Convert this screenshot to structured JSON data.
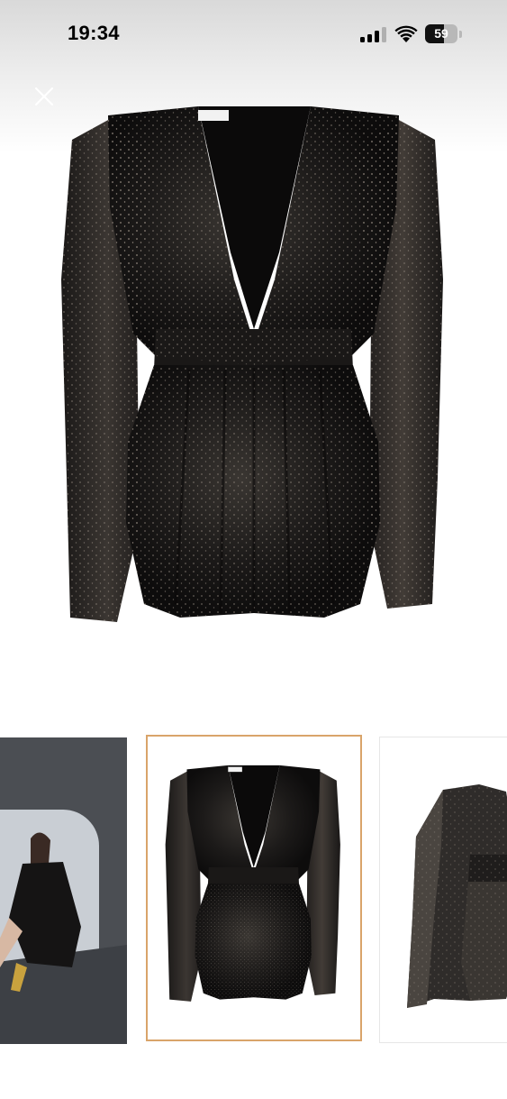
{
  "status_bar": {
    "time": "19:34",
    "battery_level": "59",
    "battery_fraction": 0.59,
    "icons": [
      "signal-icon",
      "wifi-icon",
      "battery-icon"
    ]
  },
  "header": {
    "close_icon": "close-icon"
  },
  "gallery": {
    "main_image": "black-sequin-playsuit-front-photo",
    "thumbnails": [
      {
        "image": "model-lifestyle-photo"
      },
      {
        "image": "black-sequin-playsuit-front-photo",
        "selected": true
      },
      {
        "image": "black-sequin-playsuit-side-photo"
      }
    ],
    "selected_border_color": "#d9a46a"
  }
}
